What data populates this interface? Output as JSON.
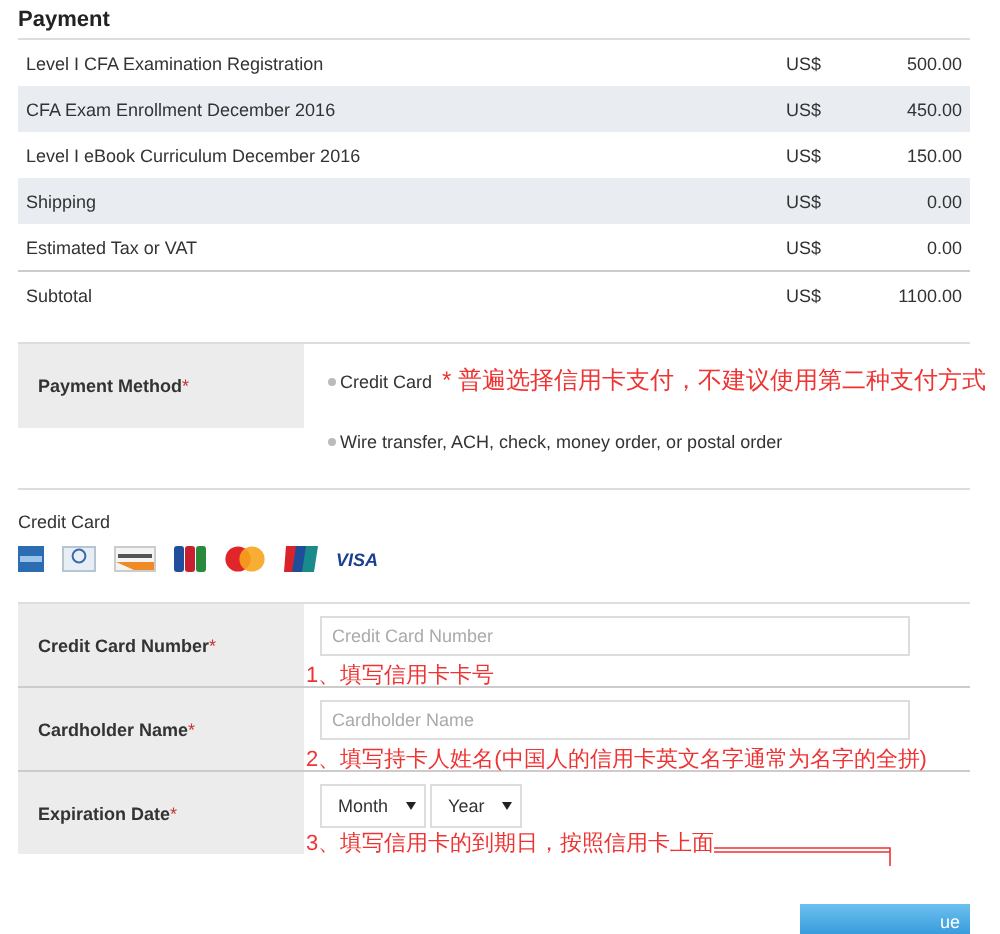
{
  "title": "Payment",
  "lines": [
    {
      "item": "Level I CFA Examination Registration",
      "currency": "US$",
      "amount": "500.00"
    },
    {
      "item": "CFA Exam Enrollment December 2016",
      "currency": "US$",
      "amount": "450.00"
    },
    {
      "item": "Level I eBook Curriculum December 2016",
      "currency": "US$",
      "amount": "150.00"
    },
    {
      "item": "Shipping",
      "currency": "US$",
      "amount": "0.00"
    },
    {
      "item": "Estimated Tax or VAT",
      "currency": "US$",
      "amount": "0.00"
    }
  ],
  "subtotal": {
    "item": "Subtotal",
    "currency": "US$",
    "amount": "1100.00"
  },
  "payment_method": {
    "label": "Payment Method",
    "required": "*",
    "options": [
      {
        "label": "Credit Card",
        "selected": false,
        "note": "* 普遍选择信用卡支付，不建议使用第二种支付方式"
      },
      {
        "label": "Wire transfer, ACH, check, money order, or postal order",
        "selected": false
      }
    ]
  },
  "credit_card": {
    "heading": "Credit Card",
    "logos": [
      {
        "kind": "amex"
      },
      {
        "kind": "diners"
      },
      {
        "kind": "discover"
      },
      {
        "kind": "jcb"
      },
      {
        "kind": "mastercard"
      },
      {
        "kind": "unionpay"
      },
      {
        "kind": "visa",
        "text": "VISA"
      }
    ]
  },
  "fields": [
    {
      "kind": "text",
      "label": "Credit Card Number",
      "required": "*",
      "placeholder": "Credit Card Number",
      "note": "1、填写信用卡卡号"
    },
    {
      "kind": "text",
      "label": "Cardholder Name",
      "required": "*",
      "placeholder": "Cardholder Name",
      "note": "2、填写持卡人姓名(中国人的信用卡英文名字通常为名字的全拼)"
    },
    {
      "kind": "date",
      "label": "Expiration Date",
      "required": "*",
      "selects": [
        "Month",
        "Year"
      ],
      "note": "3、填写信用卡的到期日，按照信用卡上面"
    }
  ],
  "button": {
    "label": "ue"
  }
}
